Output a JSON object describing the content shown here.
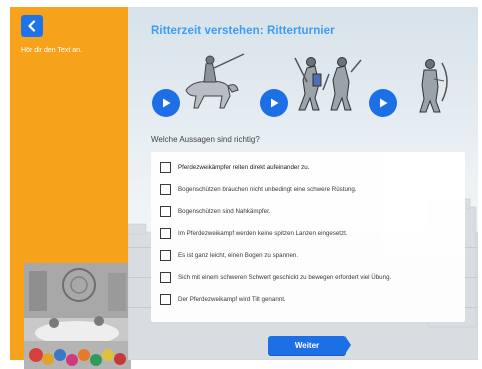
{
  "sidebar": {
    "hint": "Hör dir den Text an."
  },
  "main": {
    "title": "Ritterzeit verstehen: Ritterturnier",
    "question": "Welche Aussagen sind richtig?",
    "options": [
      {
        "label": "Pferdezweikämpfer reiten direkt aufeinander zu.",
        "checked": false
      },
      {
        "label": "Bogenschützen brauchen nicht unbedingt eine schwere Rüstung.",
        "checked": false
      },
      {
        "label": "Bogenschützen sind Nahkämpfer.",
        "checked": false
      },
      {
        "label": "Im Pferdezweikampf werden keine spitzen Lanzen eingesetzt.",
        "checked": false
      },
      {
        "label": "Es ist ganz leicht, einen Bogen zu spannen.",
        "checked": false
      },
      {
        "label": "Sich mit einem schweren Schwert geschickt zu bewegen erfordert viel Übung.",
        "checked": false
      },
      {
        "label": "Der Pferdezweikampf wird Tilt genannt.",
        "checked": false
      }
    ],
    "weiter_label": "Weiter"
  },
  "colors": {
    "sidebar": "#f7a21b",
    "accent": "#1d6fe5",
    "title": "#3b9df5"
  }
}
